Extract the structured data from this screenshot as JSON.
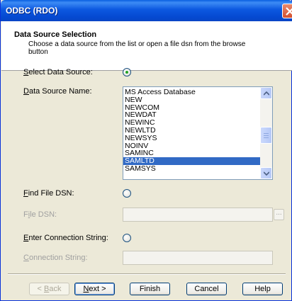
{
  "window": {
    "title": "ODBC (RDO)"
  },
  "header": {
    "title": "Data Source Selection",
    "description": "Choose a data source from the list or open a file dsn from the browse button"
  },
  "fields": {
    "select_data_source": {
      "label_accel": "S",
      "label_rest": "elect Data Source:",
      "checked": true
    },
    "data_source_name": {
      "label_accel": "D",
      "label_rest": "ata Source Name:",
      "items": [
        "MS Access Database",
        "NEW",
        "NEWCOM",
        "NEWDAT",
        "NEWINC",
        "NEWLTD",
        "NEWSYS",
        "NOINV",
        "SAMINC",
        "SAMLTD",
        "SAMSYS"
      ],
      "selected": "SAMLTD"
    },
    "find_file_dsn": {
      "label_accel": "F",
      "label_rest": "ind File DSN:",
      "checked": false
    },
    "file_dsn": {
      "label_pre": "F",
      "label_accel": "i",
      "label_rest": "le DSN:",
      "value": "",
      "browse_label": "..."
    },
    "enter_connection_string": {
      "label_accel": "E",
      "label_rest": "nter Connection String:",
      "checked": false
    },
    "connection_string": {
      "label_accel": "C",
      "label_rest": "onnection String:",
      "value": ""
    }
  },
  "buttons": {
    "back": {
      "pre": "< ",
      "accel": "B",
      "rest": "ack"
    },
    "next": {
      "accel": "N",
      "rest": "ext >"
    },
    "finish": "Finish",
    "cancel": "Cancel",
    "help": "Help"
  },
  "colors": {
    "titlebar": "#0549d1",
    "selection": "#316ac5",
    "radio_dot": "#21a121"
  }
}
